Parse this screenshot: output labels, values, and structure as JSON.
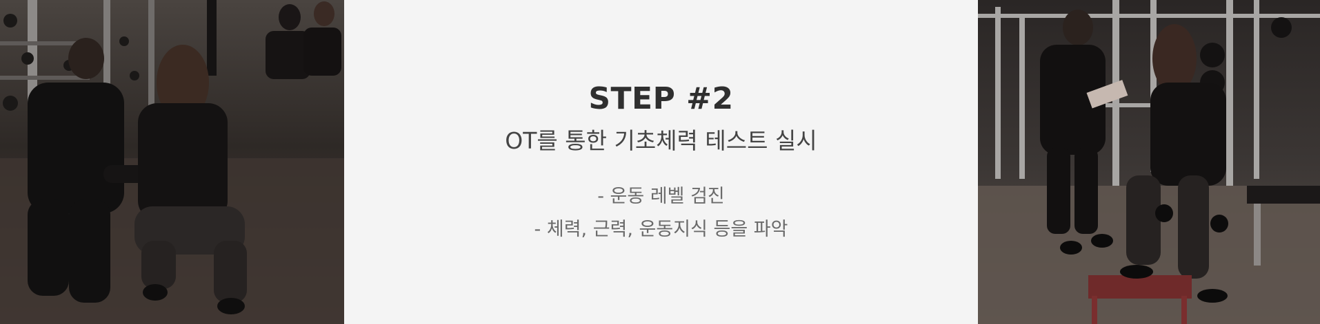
{
  "step": {
    "title": "STEP #2",
    "subtitle": "OT를 통한 기초체력 테스트 실시",
    "bullets": [
      "- 운동 레벨 검진",
      "- 체력, 근력, 운동지식 등을 파악"
    ]
  },
  "images": {
    "left": "gym-trainer-squat-photo",
    "right": "gym-trainer-clipboard-photo"
  }
}
